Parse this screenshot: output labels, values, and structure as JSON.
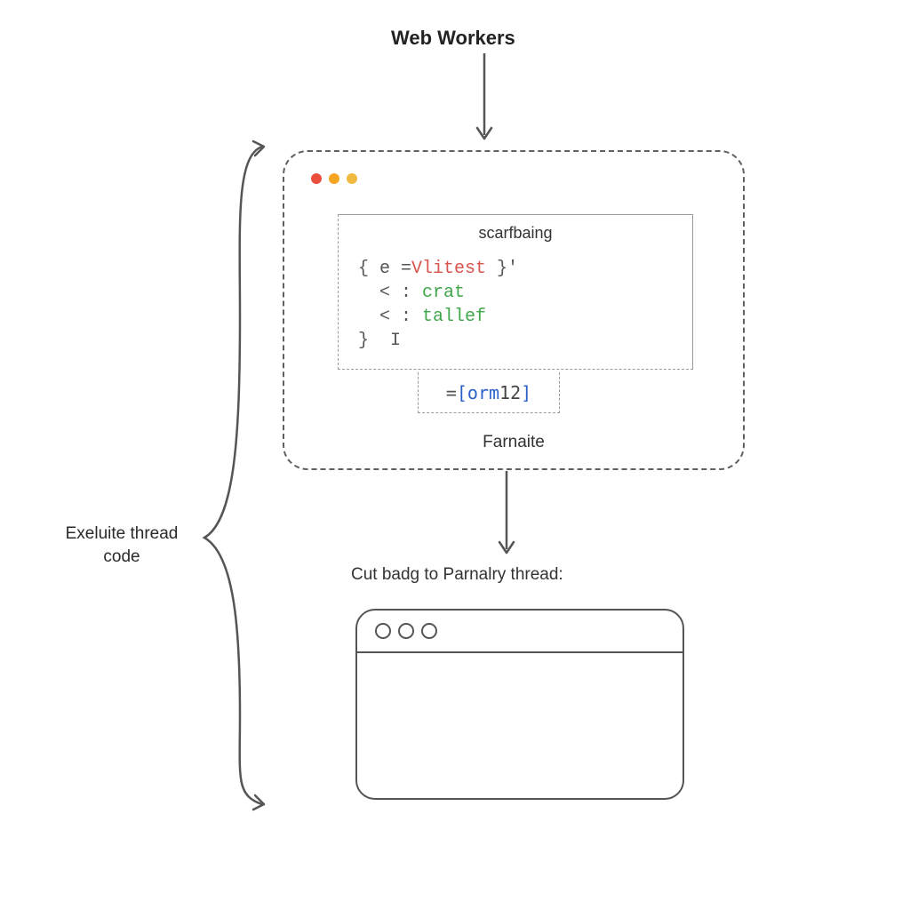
{
  "title": "Web Workers",
  "worker_box": {
    "code_heading": "scarfbaing",
    "code_lines": {
      "l1_open": "{ e =",
      "l1_token": "Vlitest",
      "l1_close": " }'",
      "l2_prefix": "  < : ",
      "l2_token": "crat",
      "l3_prefix": "  < : ",
      "l3_token": "tallef",
      "l4": "}  I"
    },
    "orm_tag": {
      "eq": "=",
      "open": "[",
      "word": "orm",
      "num": "12",
      "close": "]"
    },
    "bottom_label": "Farnaite"
  },
  "return_label": "Cut badg to Parnalry thread:",
  "left_label_line1": "Exeluite thread",
  "left_label_line2": "code"
}
